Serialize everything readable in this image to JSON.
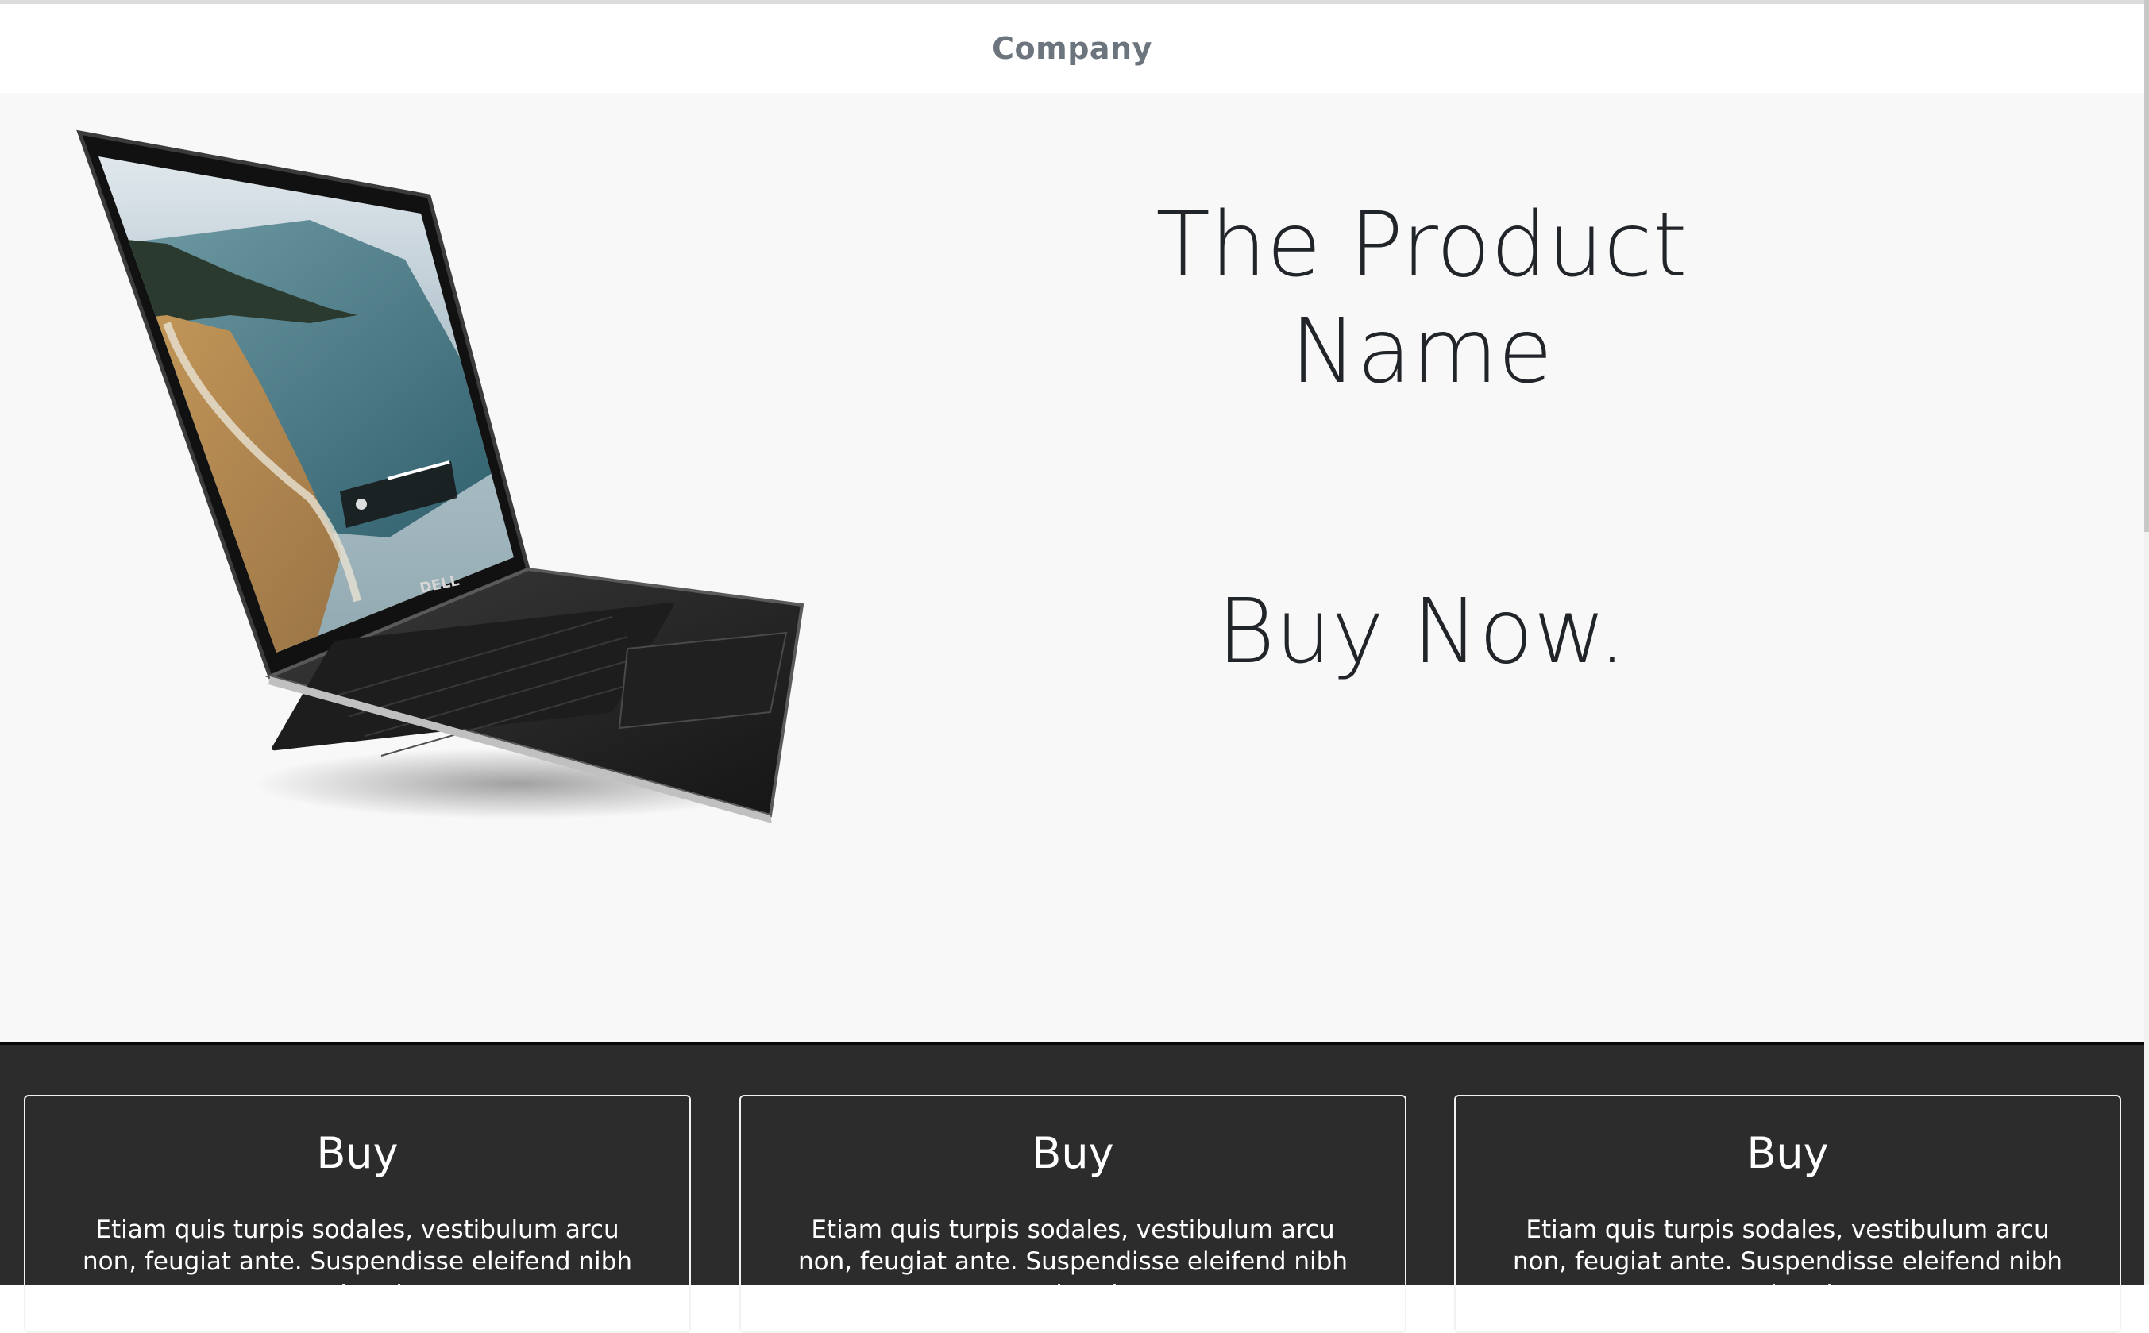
{
  "navbar": {
    "brand": "Company"
  },
  "hero": {
    "title": "The Product Name",
    "cta": "Buy Now.",
    "laptop_logo": "DELL"
  },
  "cards": [
    {
      "title": "Buy",
      "text": "Etiam quis turpis sodales, vestibulum arcu non, feugiat ante. Suspendisse eleifend nibh ante, at"
    },
    {
      "title": "Buy",
      "text": "Etiam quis turpis sodales, vestibulum arcu non, feugiat ante. Suspendisse eleifend nibh ante, at"
    },
    {
      "title": "Buy",
      "text": "Etiam quis turpis sodales, vestibulum arcu non, feugiat ante. Suspendisse eleifend nibh ante, at"
    }
  ],
  "colors": {
    "brand_text": "#6c757d",
    "hero_bg": "#f8f8f8",
    "cards_bg": "#2c2c2c",
    "heading_text": "#212529"
  }
}
